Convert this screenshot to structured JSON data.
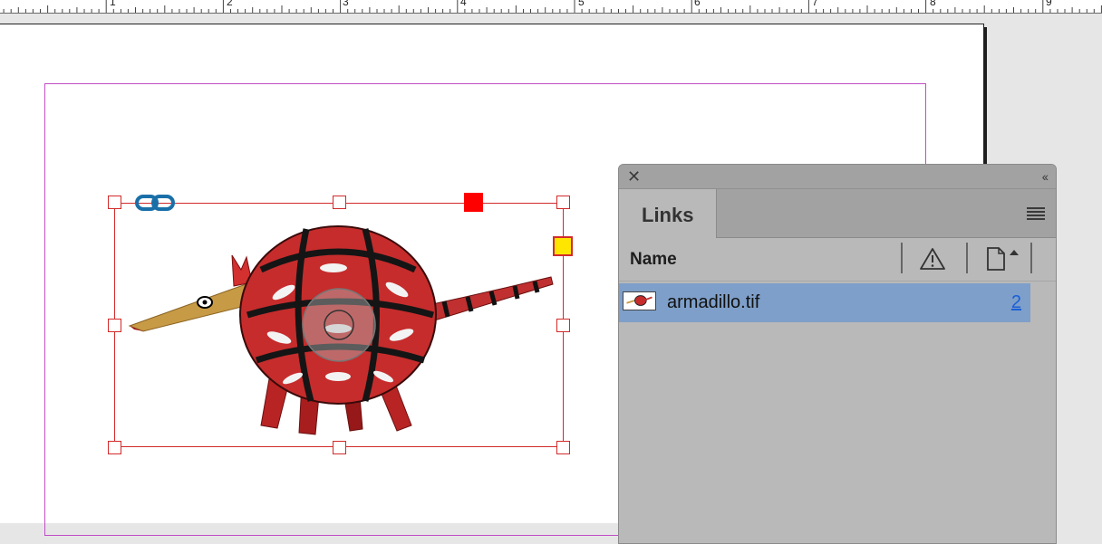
{
  "ruler": {
    "numbers": [
      "1",
      "2",
      "3",
      "4",
      "5",
      "6",
      "7",
      "8",
      "9"
    ]
  },
  "document": {
    "image_file": "armadillo.tif"
  },
  "links_panel": {
    "tab_label": "Links",
    "column_name_label": "Name",
    "rows": [
      {
        "name": "armadillo.tif",
        "page": "2"
      }
    ]
  },
  "colors": {
    "frame_border": "#d22a2a",
    "margin_guide": "#c04ec7",
    "selected_row": "#7e9fc9",
    "page_link": "#1a5fd6",
    "link_badge": "#1a6fa8"
  },
  "icons": {
    "panel_close": "close-icon",
    "panel_collapse": "collapse-icon",
    "panel_menu": "hamburger-menu-icon",
    "status_column": "warning-icon",
    "page_column": "page-icon",
    "frame_link": "link-icon"
  }
}
